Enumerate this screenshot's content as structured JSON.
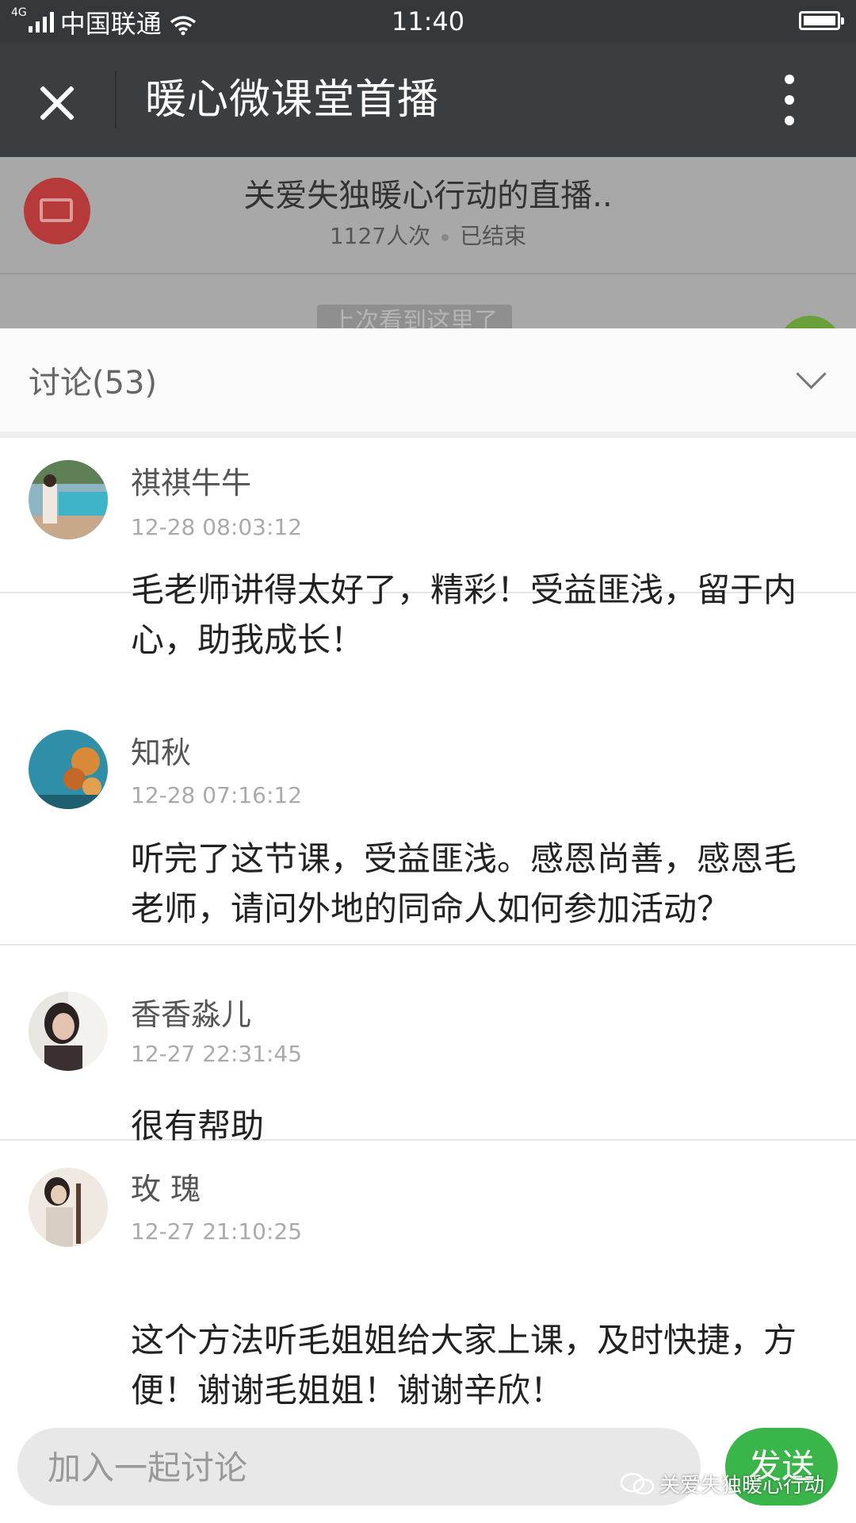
{
  "status_bar": {
    "network": "4G",
    "carrier": "中国联通",
    "time": "11:40"
  },
  "nav": {
    "title": "暖心微课堂首播"
  },
  "live": {
    "title": "关爱失独暖心行动的直播..",
    "viewers": "1127人次",
    "status": "已结束",
    "last_seen": "上次看到这里了"
  },
  "discussion": {
    "header": "讨论(53)",
    "comments": [
      {
        "name": "祺祺牛牛",
        "time": "12-28 08:03:12",
        "text": "毛老师讲得太好了，精彩！受益匪浅，留于内心，助我成长！"
      },
      {
        "name": "知秋",
        "time": "12-28 07:16:12",
        "text": "听完了这节课，受益匪浅。感恩尚善，感恩毛老师，请问外地的同命人如何参加活动？"
      },
      {
        "name": "香香淼儿",
        "time": "12-27 22:31:45",
        "text": "很有帮助"
      },
      {
        "name": "玫 瑰",
        "time": "12-27 21:10:25",
        "text": "这个方法听毛姐姐给大家上课，及时快捷，方便！谢谢毛姐姐！谢谢辛欣！"
      }
    ]
  },
  "input": {
    "placeholder": "加入一起讨论",
    "send_label": "发送"
  },
  "watermark": "关爱失独暖心行动"
}
